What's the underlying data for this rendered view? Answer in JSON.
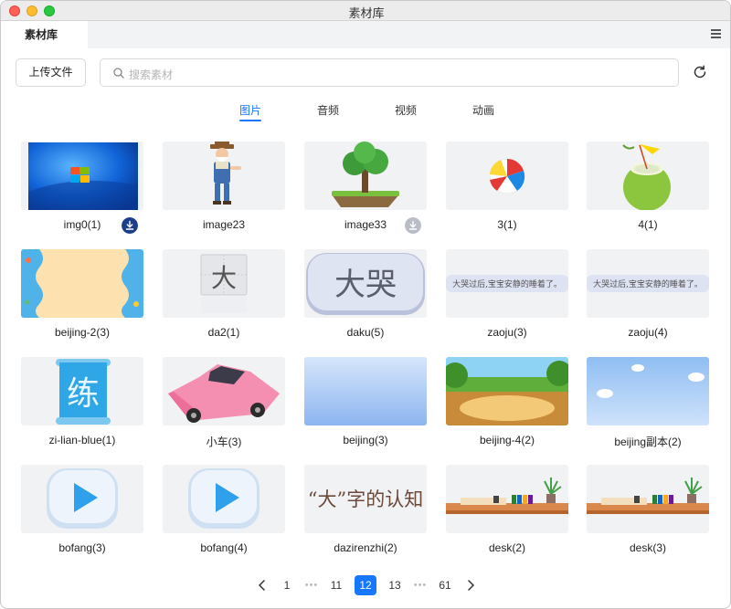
{
  "window": {
    "title": "素材库"
  },
  "tabs": [
    {
      "label": "素材库"
    }
  ],
  "toolbar": {
    "upload_label": "上传文件",
    "search_placeholder": "搜索素材"
  },
  "media_tabs": [
    {
      "label": "图片",
      "active": true
    },
    {
      "label": "音频",
      "active": false
    },
    {
      "label": "视频",
      "active": false
    },
    {
      "label": "动画",
      "active": false
    }
  ],
  "items": [
    {
      "name": "img0(1)",
      "download": true
    },
    {
      "name": "image23",
      "download": false
    },
    {
      "name": "image33",
      "download": true
    },
    {
      "name": "3(1)",
      "download": false
    },
    {
      "name": "4(1)",
      "download": false
    },
    {
      "name": "beijing-2(3)",
      "download": false
    },
    {
      "name": "da2(1)",
      "download": false,
      "thumb_text": "大"
    },
    {
      "name": "daku(5)",
      "download": false,
      "thumb_text": "大哭"
    },
    {
      "name": "zaoju(3)",
      "download": false,
      "thumb_text": "大哭过后,宝宝安静的睡着了。"
    },
    {
      "name": "zaoju(4)",
      "download": false,
      "thumb_text": "大哭过后,宝宝安静的睡着了。"
    },
    {
      "name": "zi-lian-blue(1)",
      "download": false,
      "thumb_text": "练"
    },
    {
      "name": "小车(3)",
      "download": false
    },
    {
      "name": "beijing(3)",
      "download": false
    },
    {
      "name": "beijing-4(2)",
      "download": false
    },
    {
      "name": "beijing副本(2)",
      "download": false
    },
    {
      "name": "bofang(3)",
      "download": false
    },
    {
      "name": "bofang(4)",
      "download": false
    },
    {
      "name": "dazirenzhi(2)",
      "download": false,
      "thumb_text": "“大”字的认知"
    },
    {
      "name": "desk(2)",
      "download": false
    },
    {
      "name": "desk(3)",
      "download": false
    }
  ],
  "pagination": {
    "pages": [
      "1",
      "•••",
      "11",
      "12",
      "13",
      "•••",
      "61"
    ],
    "current": "12"
  },
  "colors": {
    "accent": "#1677ff"
  }
}
